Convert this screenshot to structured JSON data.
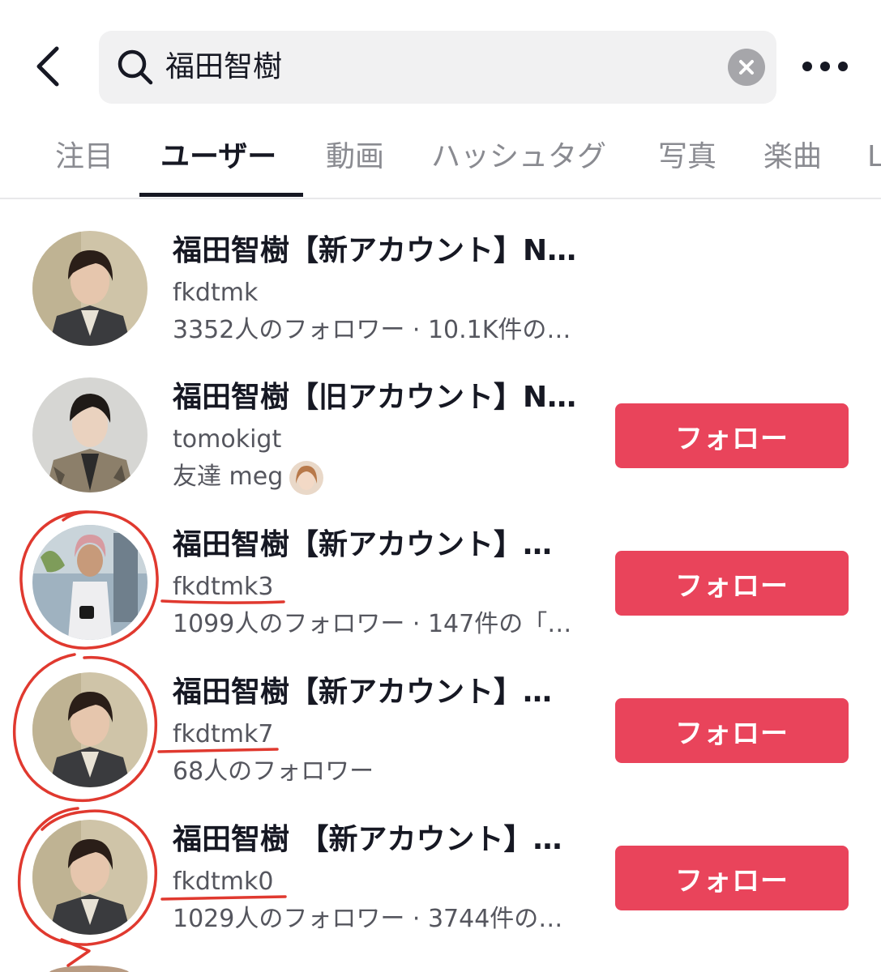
{
  "header": {
    "back_icon": "chevron-left-icon",
    "search_query": "福田智樹",
    "search_icon": "search-icon",
    "clear_icon": "clear-icon",
    "more_icon": "more-icon"
  },
  "tabs": [
    {
      "label": "注目",
      "active": false
    },
    {
      "label": "ユーザー",
      "active": true
    },
    {
      "label": "動画",
      "active": false
    },
    {
      "label": "ハッシュタグ",
      "active": false
    },
    {
      "label": "写真",
      "active": false
    },
    {
      "label": "楽曲",
      "active": false
    },
    {
      "label": "L",
      "active": false
    }
  ],
  "users": [
    {
      "name": "福田智樹【新アカウント】N…",
      "handle": "fkdtmk",
      "meta": "3352人のフォロワー · 10.1K件の…",
      "show_follow": false
    },
    {
      "name": "福田智樹【旧アカウント】N…",
      "handle": "tomokigt",
      "meta": "友達 meg",
      "show_follow": true,
      "follow_label": "フォロー"
    },
    {
      "name": "福田智樹【新アカウント】…",
      "handle": "fkdtmk3",
      "meta": "1099人のフォロワー · 147件の「…",
      "show_follow": true,
      "follow_label": "フォロー"
    },
    {
      "name": "福田智樹【新アカウント】…",
      "handle": "fkdtmk7",
      "meta": "68人のフォロワー",
      "show_follow": true,
      "follow_label": "フォロー"
    },
    {
      "name": "福田智樹 【新アカウント】…",
      "handle": "fkdtmk0",
      "meta": "1029人のフォロワー · 3744件の…",
      "show_follow": true,
      "follow_label": "フォロー"
    }
  ],
  "colors": {
    "accent": "#e9445b",
    "annotation": "#e0392f",
    "text_primary": "#161823",
    "text_secondary": "#55565e"
  }
}
